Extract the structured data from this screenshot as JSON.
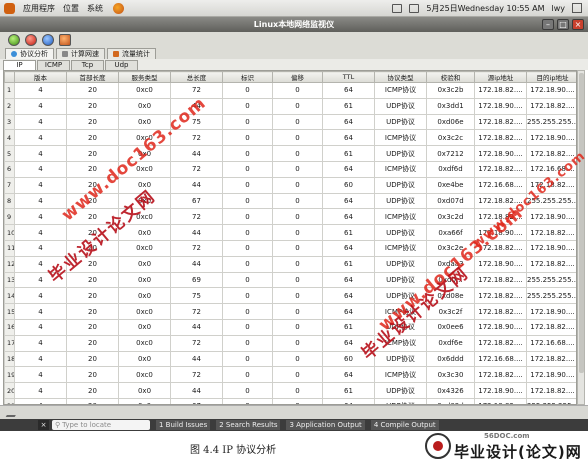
{
  "topbar": {
    "menus": [
      "应用程序",
      "位置",
      "系统"
    ],
    "clock": "5月25日Wednesday 10:55 AM",
    "user": "lwy"
  },
  "window": {
    "title": "Linux本地网络监视仪"
  },
  "main_tabs": [
    "协议分析",
    "计算网速",
    "流量统计"
  ],
  "sub_tabs": [
    "IP",
    "ICMP",
    "Tcp",
    "Udp"
  ],
  "table": {
    "columns": [
      "版本",
      "首部长度",
      "服务类型",
      "总长度",
      "标识",
      "偏移",
      "TTL",
      "协议类型",
      "校验和",
      "源ip地址",
      "目的ip地址"
    ],
    "rows": [
      [
        "1",
        "4",
        "20",
        "0xc0",
        "72",
        "0",
        "0",
        "64",
        "ICMP协议",
        "0x3c2b",
        "172.18.82....",
        "172.18.90...."
      ],
      [
        "2",
        "4",
        "20",
        "0x0",
        "44",
        "0",
        "0",
        "61",
        "UDP协议",
        "0x3dd1",
        "172.18.90....",
        "172.18.82...."
      ],
      [
        "3",
        "4",
        "20",
        "0x0",
        "75",
        "0",
        "0",
        "64",
        "UDP协议",
        "0xd06e",
        "172.18.82....",
        "255.255.255...."
      ],
      [
        "4",
        "4",
        "20",
        "0xc0",
        "72",
        "0",
        "0",
        "64",
        "ICMP协议",
        "0x3c2c",
        "172.18.82....",
        "172.18.90...."
      ],
      [
        "5",
        "4",
        "20",
        "0x0",
        "44",
        "0",
        "0",
        "61",
        "UDP协议",
        "0x7212",
        "172.18.90....",
        "172.18.82...."
      ],
      [
        "6",
        "4",
        "20",
        "0xc0",
        "72",
        "0",
        "0",
        "64",
        "ICMP协议",
        "0xdf6d",
        "172.18.82....",
        "172.16.68...."
      ],
      [
        "7",
        "4",
        "20",
        "0x0",
        "44",
        "0",
        "0",
        "60",
        "UDP协议",
        "0xe4be",
        "172.16.68....",
        "172.18.82...."
      ],
      [
        "8",
        "4",
        "20",
        "0x0",
        "67",
        "0",
        "0",
        "64",
        "UDP协议",
        "0xd07d",
        "172.18.82....",
        "255.255.255...."
      ],
      [
        "9",
        "4",
        "20",
        "0xc0",
        "72",
        "0",
        "0",
        "64",
        "ICMP协议",
        "0x3c2d",
        "172.18.82....",
        "172.18.90...."
      ],
      [
        "10",
        "4",
        "20",
        "0x0",
        "44",
        "0",
        "0",
        "61",
        "UDP协议",
        "0xa66f",
        "172.18.90....",
        "172.18.82...."
      ],
      [
        "11",
        "4",
        "20",
        "0xc0",
        "72",
        "0",
        "0",
        "64",
        "ICMP协议",
        "0x3c2e",
        "172.18.82....",
        "172.18.90...."
      ],
      [
        "12",
        "4",
        "20",
        "0x0",
        "44",
        "0",
        "0",
        "61",
        "UDP协议",
        "0xdaa3",
        "172.18.90....",
        "172.18.82...."
      ],
      [
        "13",
        "4",
        "20",
        "0x0",
        "69",
        "0",
        "0",
        "64",
        "UDP协议",
        "0xd0...",
        "172.18.82....",
        "255.255.255...."
      ],
      [
        "14",
        "4",
        "20",
        "0x0",
        "75",
        "0",
        "0",
        "64",
        "UDP协议",
        "0xd08e",
        "172.18.82....",
        "255.255.255...."
      ],
      [
        "15",
        "4",
        "20",
        "0xc0",
        "72",
        "0",
        "0",
        "64",
        "ICMP协议",
        "0x3c2f",
        "172.18.82....",
        "172.18.90...."
      ],
      [
        "16",
        "4",
        "20",
        "0x0",
        "44",
        "0",
        "0",
        "61",
        "UDP协议",
        "0x0ee6",
        "172.18.90....",
        "172.18.82...."
      ],
      [
        "17",
        "4",
        "20",
        "0xc0",
        "72",
        "0",
        "0",
        "64",
        "ICMP协议",
        "0xdf6e",
        "172.18.82....",
        "172.16.68...."
      ],
      [
        "18",
        "4",
        "20",
        "0x0",
        "44",
        "0",
        "0",
        "60",
        "UDP协议",
        "0x6ddd",
        "172.16.68....",
        "172.18.82...."
      ],
      [
        "19",
        "4",
        "20",
        "0xc0",
        "72",
        "0",
        "0",
        "64",
        "ICMP协议",
        "0x3c30",
        "172.18.82....",
        "172.18.90...."
      ],
      [
        "20",
        "4",
        "20",
        "0x0",
        "44",
        "0",
        "0",
        "61",
        "UDP协议",
        "0x4326",
        "172.18.90....",
        "172.18.82...."
      ],
      [
        "21",
        "4",
        "20",
        "0x0",
        "67",
        "0",
        "0",
        "64",
        "UDP协议",
        "0xd09d",
        "172.18.82....",
        "255.255.255...."
      ]
    ]
  },
  "ide": {
    "locate_placeholder": "Type to locate",
    "panes": [
      "1 Build Issues",
      "2 Search Results",
      "3 Application Output",
      "4 Compile Output"
    ]
  },
  "caption": "图 4.4 IP 协议分析",
  "watermarks": {
    "url": "www.doc163.com",
    "cn": "毕业设计论文网"
  },
  "logo": {
    "site": "56DOC.com",
    "text": "毕业设计(论文)网"
  },
  "colors": {
    "watermark_red": "#e0281c",
    "logo_red": "#b91c1c"
  }
}
